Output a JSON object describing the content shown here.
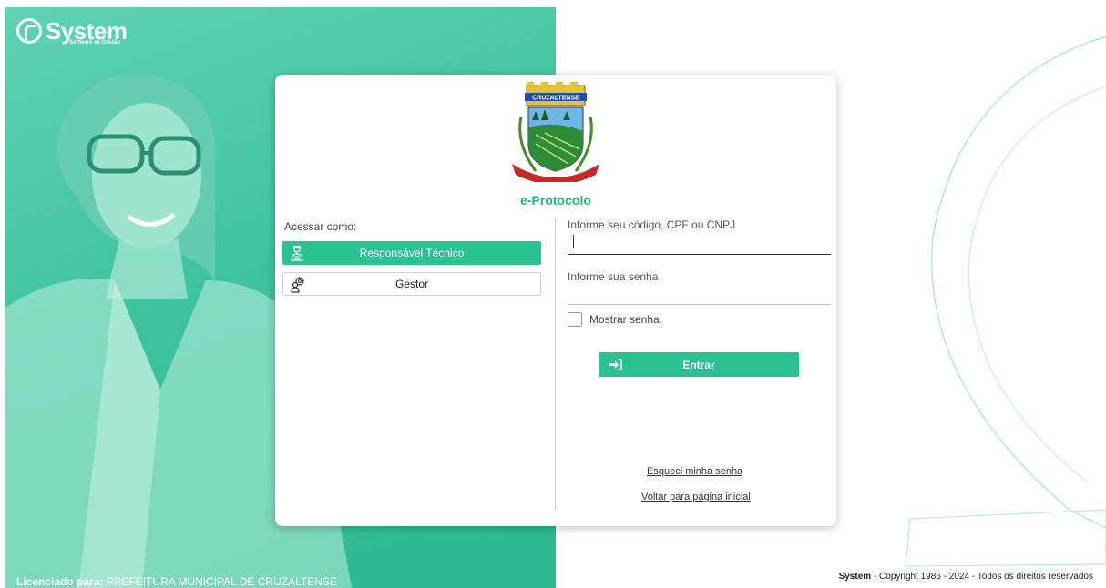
{
  "brand": {
    "name": "System",
    "tagline": "Software de Gestão"
  },
  "license": {
    "label": "Licenciado para:",
    "value": "PREFEITURA MUNICIPAL DE CRUZALTENSE"
  },
  "footer": {
    "brand": "System",
    "text": "- Copyright 1986 - 2024 - Todos os direitos reservados"
  },
  "login_card": {
    "crest_banner": "CRUZALTENSE",
    "app_title": "e-Protocolo",
    "access_label": "Acessar como:",
    "roles": [
      {
        "label": "Responsável Técnico",
        "active": true,
        "icon": "technician-icon"
      },
      {
        "label": "Gestor",
        "active": false,
        "icon": "manager-icon"
      }
    ],
    "user_field": {
      "label": "Informe seu código, CPF ou CNPJ",
      "value": ""
    },
    "password_field": {
      "label": "Informe sua senha",
      "value": ""
    },
    "show_password": {
      "label": "Mostrar senha",
      "checked": false
    },
    "submit": {
      "label": "Entrar",
      "icon": "sign-in-icon"
    },
    "links": {
      "forgot": "Esqueci minha senha",
      "back": "Voltar para página inicial"
    }
  },
  "colors": {
    "accent": "#2bc193",
    "title": "#26b389",
    "panel": "#3fc39f"
  }
}
